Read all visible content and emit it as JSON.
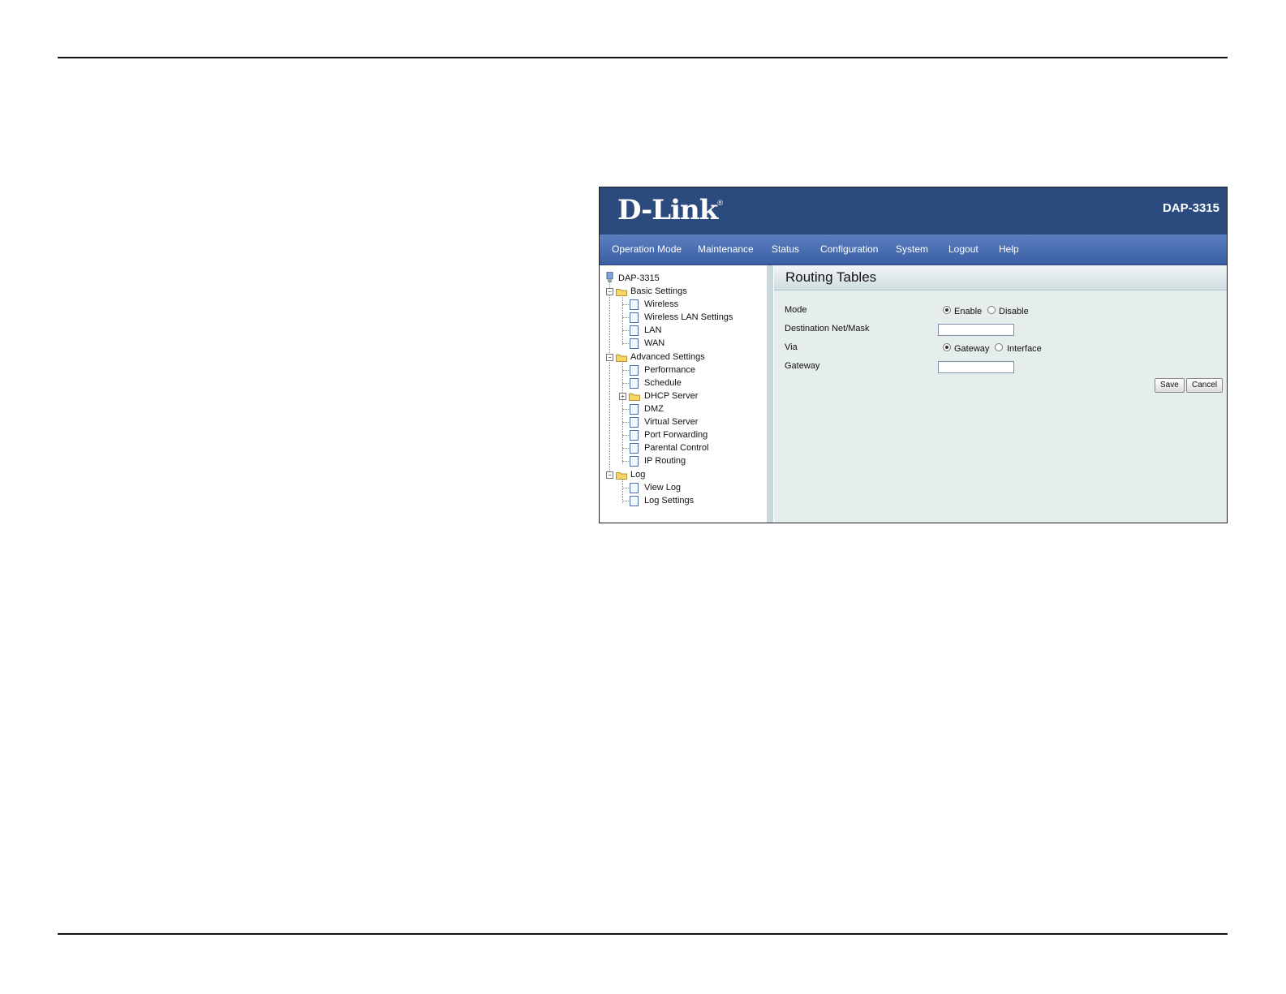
{
  "header": {
    "logo": "D-Link",
    "logo_mark": "®",
    "model": "DAP-3315"
  },
  "nav": {
    "items": [
      "Operation Mode",
      "Maintenance",
      "Status",
      "Configuration",
      "System",
      "Logout",
      "Help"
    ]
  },
  "tree": {
    "root": "DAP-3315",
    "basic": {
      "label": "Basic Settings",
      "children": [
        "Wireless",
        "Wireless LAN Settings",
        "LAN",
        "WAN"
      ]
    },
    "advanced": {
      "label": "Advanced Settings",
      "children": [
        "Performance",
        "Schedule",
        "DHCP Server",
        "DMZ",
        "Virtual Server",
        "Port Forwarding",
        "Parental Control",
        "IP Routing"
      ]
    },
    "log": {
      "label": "Log",
      "children": [
        "View Log",
        "Log Settings"
      ]
    }
  },
  "form": {
    "title": "Routing Tables",
    "mode_label": "Mode",
    "mode_enable": "Enable",
    "mode_disable": "Disable",
    "mode_selected": "Enable",
    "dest_label": "Destination Net/Mask",
    "dest_value": "",
    "via_label": "Via",
    "via_gateway": "Gateway",
    "via_interface": "Interface",
    "via_selected": "Gateway",
    "gateway_label": "Gateway",
    "gateway_value": "",
    "save": "Save",
    "cancel": "Cancel"
  }
}
